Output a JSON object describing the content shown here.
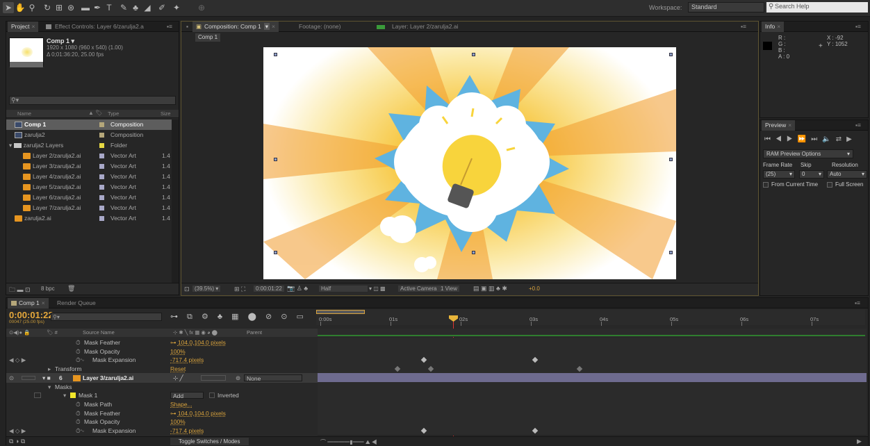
{
  "workspace": {
    "label": "Workspace:",
    "value": "Standard"
  },
  "search_help": {
    "placeholder": "Search Help"
  },
  "project": {
    "tab": "Project",
    "effect_tab": "Effect Controls: Layer 6/zarulja2.a",
    "comp_name": "Comp 1 ▾",
    "comp_size": "1920 x 1080  (960 x 540) (1.00)",
    "comp_duration": "Δ 0;01:36:20, 25.00 fps",
    "search_placeholder": "",
    "col_name": "Name",
    "col_type": "Type",
    "col_size": "Size",
    "bpc": "8 bpc",
    "items": [
      {
        "name": "Comp 1",
        "type": "Composition",
        "size": "",
        "color": "#b5a77a",
        "icon": "composition-icon",
        "selected": true
      },
      {
        "name": "zarulja2",
        "type": "Composition",
        "size": "",
        "color": "#b5a77a",
        "icon": "composition-icon"
      },
      {
        "name": "zarulja2 Layers",
        "type": "Folder",
        "size": "",
        "color": "#e6d843",
        "icon": "folder-icon"
      },
      {
        "name": "Layer 2/zarulja2.ai",
        "type": "Vector Art",
        "size": "1.4",
        "color": "#a8a8c8",
        "icon": "ai-file-icon"
      },
      {
        "name": "Layer 3/zarulja2.ai",
        "type": "Vector Art",
        "size": "1.4",
        "color": "#a8a8c8",
        "icon": "ai-file-icon"
      },
      {
        "name": "Layer 4/zarulja2.ai",
        "type": "Vector Art",
        "size": "1.4",
        "color": "#a8a8c8",
        "icon": "ai-file-icon"
      },
      {
        "name": "Layer 5/zarulja2.ai",
        "type": "Vector Art",
        "size": "1.4",
        "color": "#a8a8c8",
        "icon": "ai-file-icon"
      },
      {
        "name": "Layer 6/zarulja2.ai",
        "type": "Vector Art",
        "size": "1.4",
        "color": "#a8a8c8",
        "icon": "ai-file-icon"
      },
      {
        "name": "Layer 7/zarulja2.ai",
        "type": "Vector Art",
        "size": "1.4",
        "color": "#a8a8c8",
        "icon": "ai-file-icon"
      },
      {
        "name": "zarulja2.ai",
        "type": "Vector Art",
        "size": "1.4",
        "color": "#a8a8c8",
        "icon": "ai-file-icon"
      }
    ]
  },
  "composition": {
    "tab": "Composition: Comp 1",
    "footage_tab": "Footage: (none)",
    "layer_tab": "Layer: Layer 2/zarulja2.ai",
    "breadcrumb": "Comp 1",
    "zoom": "(39.5%)",
    "timecode": "0:00:01:22",
    "resolution": "Half",
    "camera": "Active Camera",
    "views": "1 View",
    "exposure": "+0.0"
  },
  "info": {
    "tab": "Info",
    "r": "R :",
    "g": "G :",
    "b": "B :",
    "a": "A : 0",
    "x": "X : -92",
    "y": "Y : 1052"
  },
  "preview": {
    "tab": "Preview",
    "ram_options": "RAM Preview Options",
    "frame_rate_label": "Frame Rate",
    "skip_label": "Skip",
    "resolution_label": "Resolution",
    "frame_rate": "(25)",
    "skip": "0",
    "resolution": "Auto",
    "from_current": "From Current Time",
    "full_screen": "Full Screen"
  },
  "timeline": {
    "tab": "Comp 1",
    "render_queue_tab": "Render Queue",
    "timecode": "0:00:01:22",
    "frame_info": "00047 (25.00 fps)",
    "source_name_header": "Source Name",
    "parent_header": "Parent",
    "toggle_label": "Toggle Switches / Modes",
    "ruler": [
      "0:00s",
      "01s",
      "02s",
      "03s",
      "04s",
      "05s",
      "06s",
      "07s"
    ],
    "rows": [
      {
        "name": "Mask Feather",
        "value": "104.0,104.0 pixels",
        "indent": 1,
        "stopwatch": true
      },
      {
        "name": "Mask Opacity",
        "value": "100%",
        "indent": 1,
        "stopwatch": true
      },
      {
        "name": "Mask Expansion",
        "value": "-717.4 pixels",
        "indent": 1,
        "stopwatch": true,
        "keys": true
      },
      {
        "name": "Transform",
        "value": "Reset",
        "indent": 0,
        "expander": true
      },
      {
        "name": "Layer 3/zarulja2.ai",
        "value": "",
        "indent": -1,
        "layer": true,
        "number": "6",
        "parent": "None"
      },
      {
        "name": "Masks",
        "value": "",
        "indent": 0,
        "expander": true
      },
      {
        "name": "Mask 1",
        "value": "",
        "indent": 0,
        "mask": true,
        "mode": "Add",
        "inverted": "Inverted"
      },
      {
        "name": "Mask Path",
        "value": "Shape...",
        "indent": 1,
        "stopwatch": true
      },
      {
        "name": "Mask Feather",
        "value": "104.0,104.0 pixels",
        "indent": 1,
        "stopwatch": true
      },
      {
        "name": "Mask Opacity",
        "value": "100%",
        "indent": 1,
        "stopwatch": true
      },
      {
        "name": "Mask Expansion",
        "value": "-717.4 pixels",
        "indent": 1,
        "stopwatch": true,
        "keys": true
      }
    ]
  }
}
